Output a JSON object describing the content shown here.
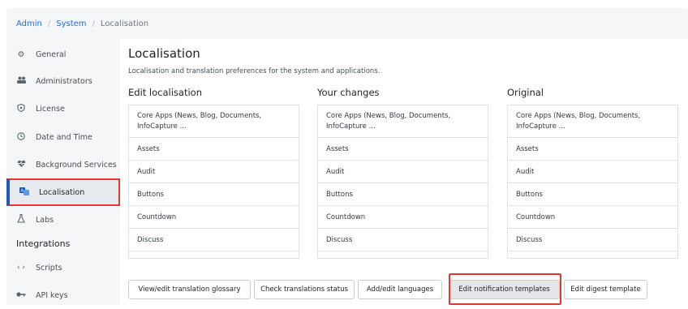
{
  "breadcrumb": {
    "items": [
      "Admin",
      "System",
      "Localisation"
    ],
    "separator": "/"
  },
  "sidebar": {
    "items": [
      {
        "label": "General",
        "icon": "gears-icon"
      },
      {
        "label": "Administrators",
        "icon": "users-icon"
      },
      {
        "label": "License",
        "icon": "badge-icon"
      },
      {
        "label": "Date and Time",
        "icon": "clock-icon"
      },
      {
        "label": "Background Services",
        "icon": "heartbeat-icon"
      },
      {
        "label": "Localisation",
        "icon": "language-icon",
        "active": true
      },
      {
        "label": "Labs",
        "icon": "flask-icon"
      }
    ],
    "section_heading": "Integrations",
    "section_items": [
      {
        "label": "Scripts",
        "icon": "code-icon"
      },
      {
        "label": "API keys",
        "icon": "key-icon"
      }
    ]
  },
  "main": {
    "title": "Localisation",
    "description": "Localisation and translation preferences for the system and applications.",
    "columns": [
      {
        "title": "Edit localisation",
        "rows": [
          "Core Apps (News, Blog, Documents,",
          "InfoCapture ...",
          "Assets",
          "Audit",
          "Buttons",
          "Countdown",
          "Discuss"
        ]
      },
      {
        "title": "Your changes",
        "rows": [
          "Core Apps (News, Blog, Documents,",
          "InfoCapture ...",
          "Assets",
          "Audit",
          "Buttons",
          "Countdown",
          "Discuss"
        ]
      },
      {
        "title": "Original",
        "rows": [
          "Core Apps (News, Blog, Documents,",
          "InfoCapture ...",
          "Assets",
          "Audit",
          "Buttons",
          "Countdown",
          "Discuss"
        ]
      }
    ],
    "buttons": [
      "View/edit translation glossary",
      "Check translations status",
      "Add/edit languages",
      "Edit notification templates",
      "Edit digest template"
    ]
  },
  "colors": {
    "link": "#1a6ee0",
    "highlight_border": "#e03a2e",
    "active_accent": "#1a5bbf",
    "sidebar_bg": "#f5f6f7"
  }
}
